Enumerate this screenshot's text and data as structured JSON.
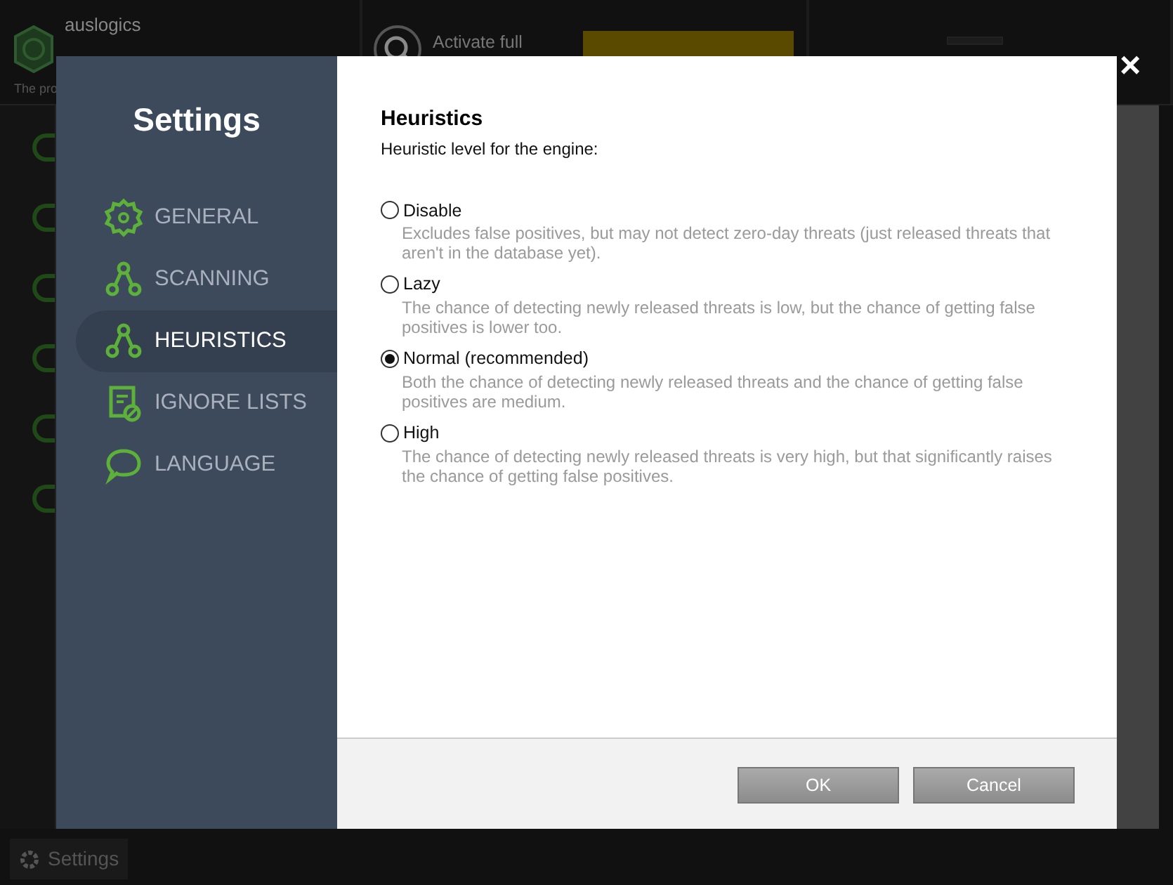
{
  "background_app": {
    "brand": "auslogics",
    "tagline": "The pro",
    "activate_text": "Activate full",
    "footer_settings": "Settings"
  },
  "dialog": {
    "title": "Settings",
    "close": "×",
    "nav": [
      {
        "label": "GENERAL",
        "kind": "gear",
        "selected": false
      },
      {
        "label": "SCANNING",
        "kind": "nodes",
        "selected": false
      },
      {
        "label": "HEURISTICS",
        "kind": "nodes",
        "selected": true
      },
      {
        "label": "IGNORE LISTS",
        "kind": "list",
        "selected": false
      },
      {
        "label": "LANGUAGE",
        "kind": "chat",
        "selected": false
      }
    ],
    "section_title": "Heuristics",
    "section_subtitle": "Heuristic level for the engine:",
    "options": [
      {
        "label": "Disable",
        "description": "Excludes false positives, but may not detect zero-day threats (just released threats that aren't in the database yet).",
        "selected": false
      },
      {
        "label": "Lazy",
        "description": "The chance of detecting newly released threats is low, but the chance of getting false positives is lower too.",
        "selected": false
      },
      {
        "label": "Normal (recommended)",
        "description": "Both the chance of detecting newly released threats and the chance of getting false positives are medium.",
        "selected": true
      },
      {
        "label": "High",
        "description": "The chance of detecting newly released threats is very high, but that significantly raises the chance of getting false positives.",
        "selected": false
      }
    ],
    "buttons": [
      "OK",
      "Cancel"
    ]
  }
}
